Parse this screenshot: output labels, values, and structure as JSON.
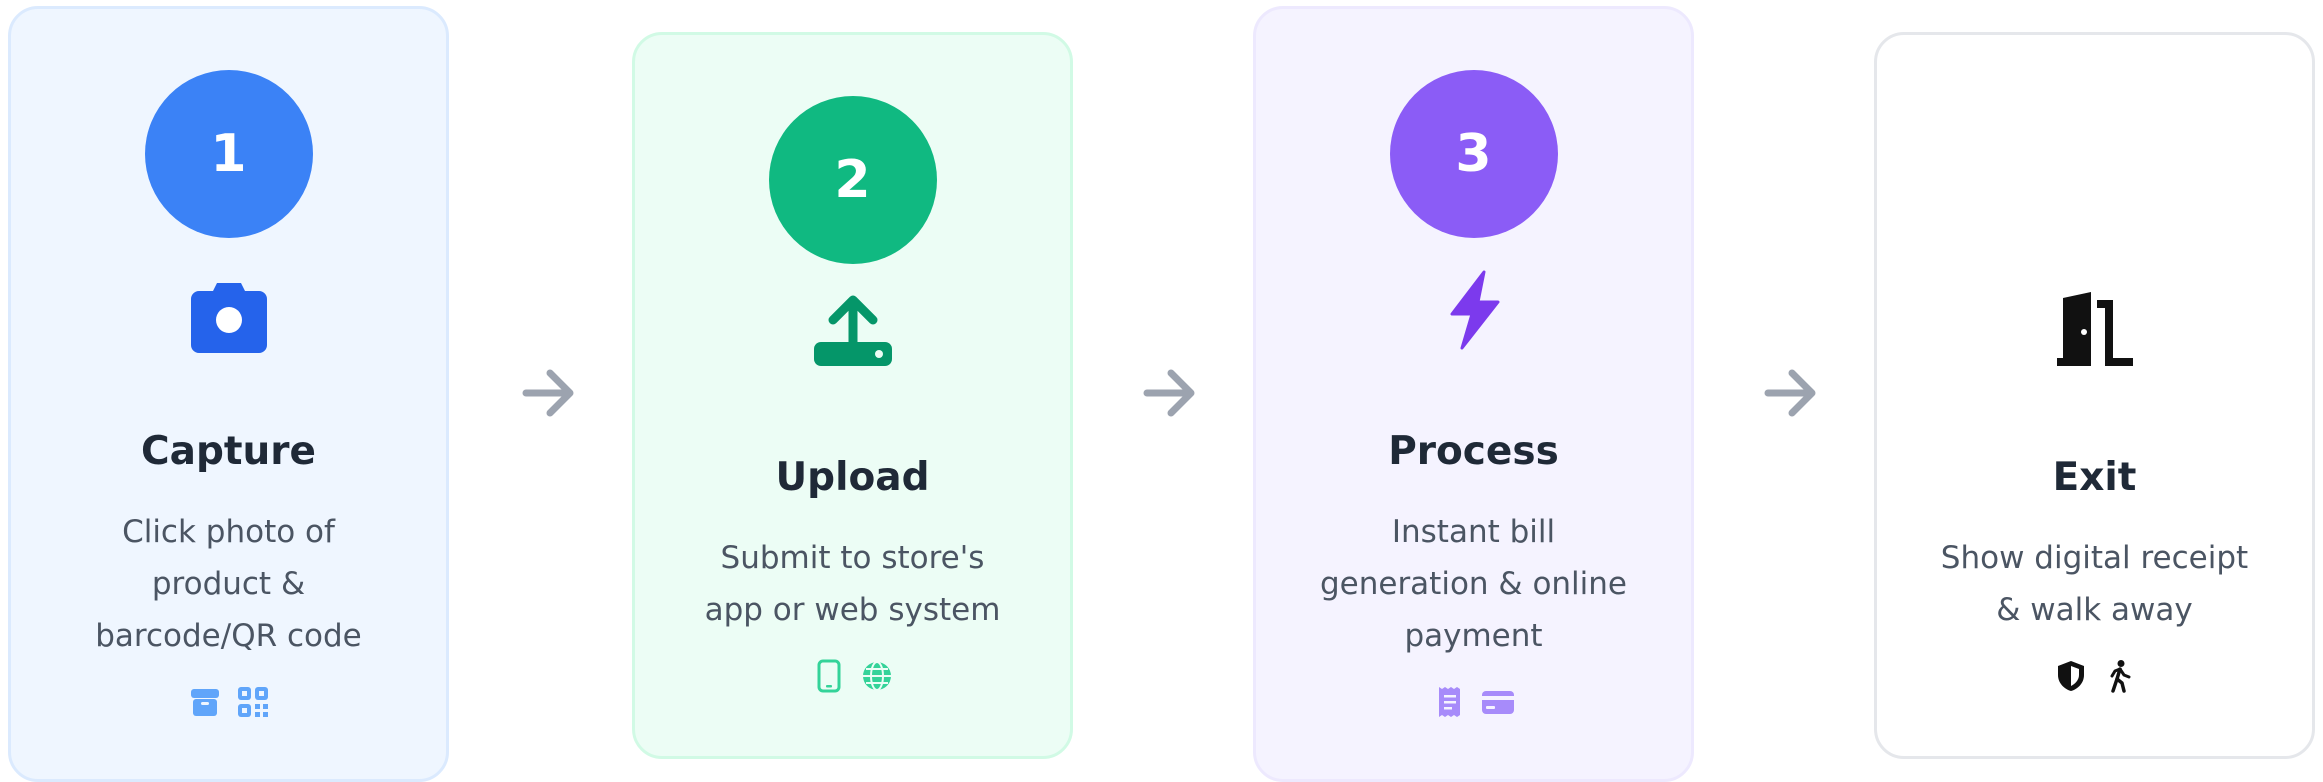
{
  "steps": [
    {
      "number": "1",
      "title": "Capture",
      "description": [
        "Click photo of",
        "product &",
        "barcode/QR code"
      ],
      "main_icon": "camera-icon",
      "sub_icons": [
        "package-icon",
        "qr-code-icon"
      ],
      "accent": "#3b82f6",
      "icon_color": "#2563eb",
      "sub_icon_color": "#60a5fa"
    },
    {
      "number": "2",
      "title": "Upload",
      "description": [
        "Submit to store's",
        "app or web system"
      ],
      "main_icon": "upload-icon",
      "sub_icons": [
        "smartphone-icon",
        "globe-icon"
      ],
      "accent": "#10b981",
      "icon_color": "#059669",
      "sub_icon_color": "#34d399"
    },
    {
      "number": "3",
      "title": "Process",
      "description": [
        "Instant bill",
        "generation & online",
        "payment"
      ],
      "main_icon": "bolt-icon",
      "sub_icons": [
        "receipt-icon",
        "credit-card-icon"
      ],
      "accent": "#8b5cf6",
      "icon_color": "#7c3aed",
      "sub_icon_color": "#a78bfa"
    },
    {
      "title": "Exit",
      "description": [
        "Show digital receipt",
        "& walk away"
      ],
      "main_icon": "door-exit-icon",
      "sub_icons": [
        "shield-icon",
        "walking-person-icon"
      ],
      "icon_color": "#111111",
      "sub_icon_color": "#111111"
    }
  ],
  "connector_icon": "arrow-right-icon",
  "connector_color": "#9ca3af"
}
